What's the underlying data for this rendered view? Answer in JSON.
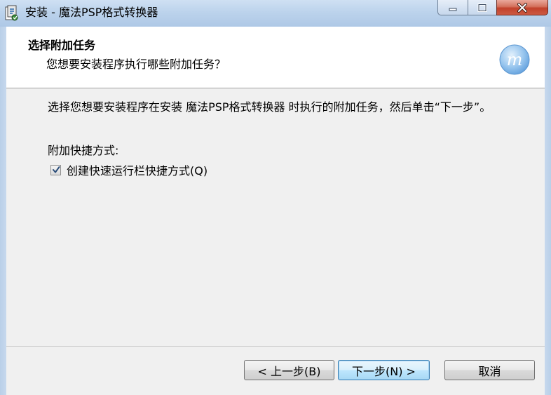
{
  "window": {
    "title": "安装 - 魔法PSP格式转换器",
    "controls": {
      "minimize_icon": "minimize-icon",
      "maximize_icon": "maximize-icon",
      "close_icon": "close-icon"
    }
  },
  "header": {
    "title": "选择附加任务",
    "subtitle": "您想要安装程序执行哪些附加任务？",
    "logo_icon": "app-logo-icon"
  },
  "body": {
    "description": "选择您想要安装程序在安装 魔法PSP格式转换器 时执行的附加任务，然后单击“下一步”。",
    "section_label": "附加快捷方式:",
    "tasks": [
      {
        "label": "创建快速运行栏快捷方式(Q)",
        "checked": true
      }
    ]
  },
  "buttons": {
    "back": "< 上一步(B)",
    "next": "下一步(N) >",
    "cancel": "取消"
  },
  "colors": {
    "title_bar": "#bcd3ec",
    "close_button": "#c2412b",
    "logo": "#7fb3e6",
    "default_button_border": "#3c7fb1"
  }
}
